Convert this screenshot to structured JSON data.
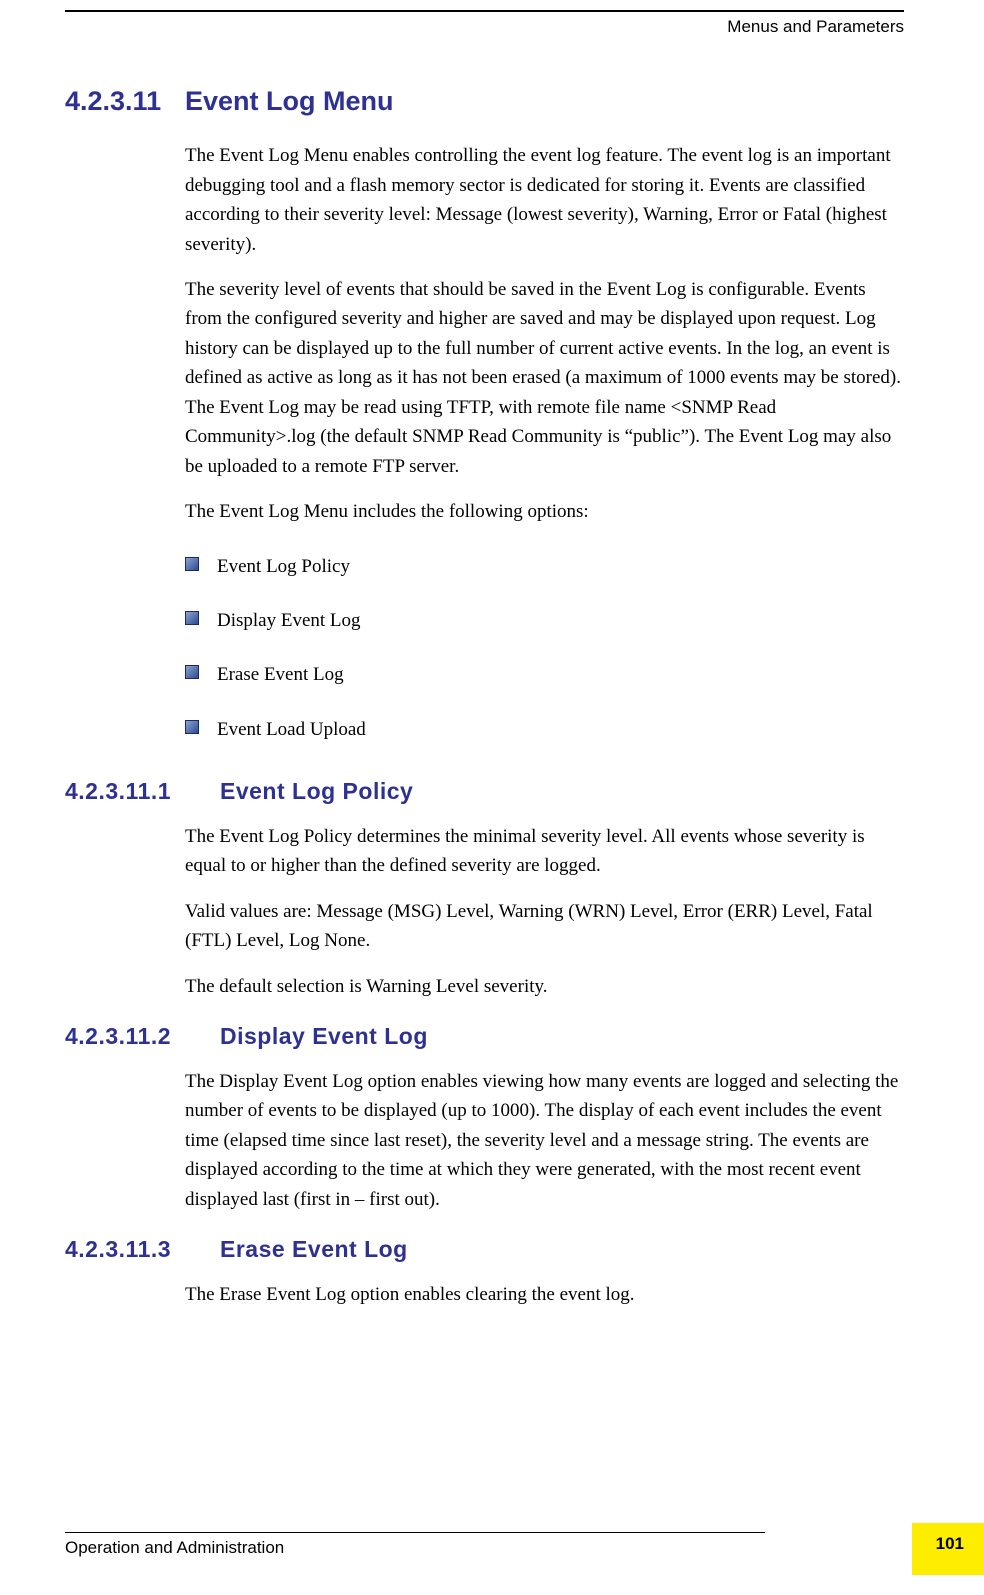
{
  "header": {
    "chapter": "Menus and Parameters"
  },
  "section": {
    "number": "4.2.3.11",
    "title": "Event Log Menu",
    "para1": "The Event Log Menu enables controlling the event log feature. The event log is an important debugging tool and a flash memory sector is dedicated for storing it. Events are classified according to their severity level: Message (lowest severity), Warning, Error or Fatal (highest severity).",
    "para2": "The severity level of events that should be saved in the Event Log is configurable. Events from the configured severity and higher are saved and may be displayed upon request. Log history can be displayed up to the full number of current active events. In the log, an event is defined as active as long as it has not been erased (a maximum of 1000 events may be stored). The Event Log may be read using TFTP, with remote file name <SNMP Read Community>.log (the default SNMP Read Community is “public”). The Event Log may also be uploaded to a remote FTP server.",
    "para3": "The Event Log Menu includes the following options:",
    "bullets": [
      "Event Log Policy",
      "Display Event Log",
      "Erase Event Log",
      "Event Load Upload"
    ]
  },
  "sub1": {
    "number": "4.2.3.11.1",
    "title": "Event Log Policy",
    "para1": "The Event Log Policy determines the minimal severity level. All events whose severity is equal to or higher than the defined severity are logged.",
    "para2": "Valid values are: Message (MSG) Level, Warning (WRN) Level, Error (ERR) Level, Fatal (FTL) Level, Log None.",
    "para3": "The default selection is Warning Level severity."
  },
  "sub2": {
    "number": "4.2.3.11.2",
    "title": "Display Event Log",
    "para1": "The Display Event Log option enables viewing how many events are logged and selecting the number of events to be displayed (up to 1000). The display of each event includes the event time (elapsed time since last reset), the severity level and a message string. The events are displayed according to the time at which they were generated, with the most recent event displayed last (first in – first out)."
  },
  "sub3": {
    "number": "4.2.3.11.3",
    "title": "Erase Event Log",
    "para1": "The Erase Event Log option enables clearing the event log."
  },
  "footer": {
    "text": "Operation and Administration",
    "page": "101"
  }
}
